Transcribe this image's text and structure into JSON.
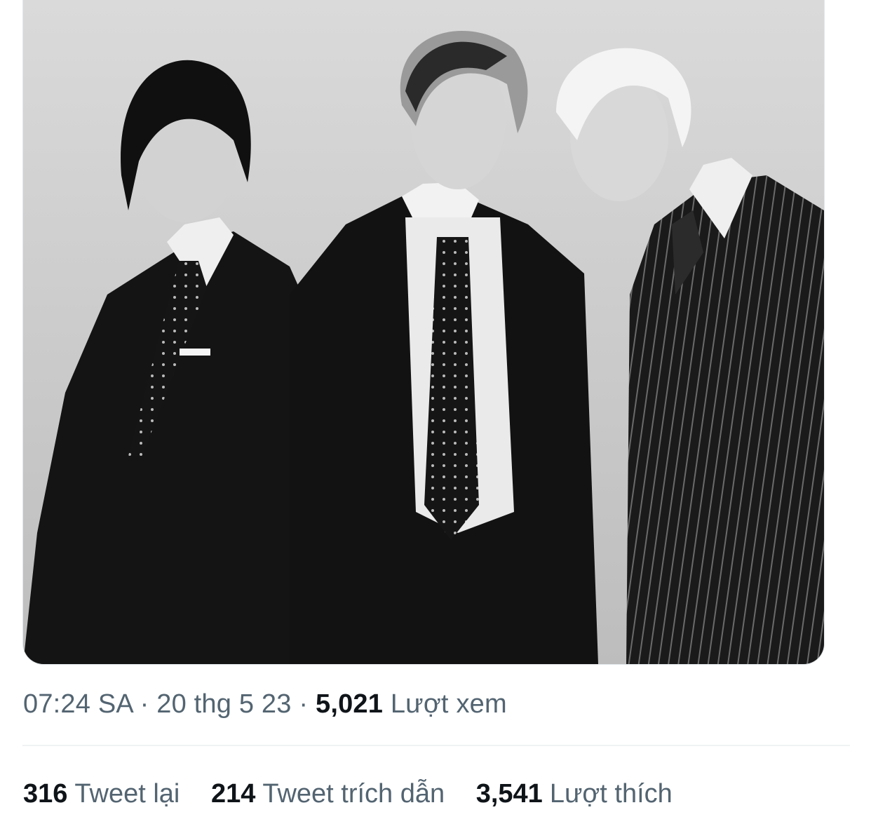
{
  "tweet": {
    "media": {
      "alt_icon": "photo-icon"
    },
    "meta": {
      "time": "07:24 SA",
      "separator": " · ",
      "date": "20 thg 5 23",
      "views_count": "5,021",
      "views_label": "Lượt xem"
    },
    "stats": [
      {
        "count": "316",
        "label": "Tweet lại"
      },
      {
        "count": "214",
        "label": "Tweet trích dẫn"
      },
      {
        "count": "3,541",
        "label": "Lượt thích"
      }
    ]
  },
  "colors": {
    "primary_text": "#0f1419",
    "secondary_text": "#536471",
    "divider": "#eff3f4"
  }
}
